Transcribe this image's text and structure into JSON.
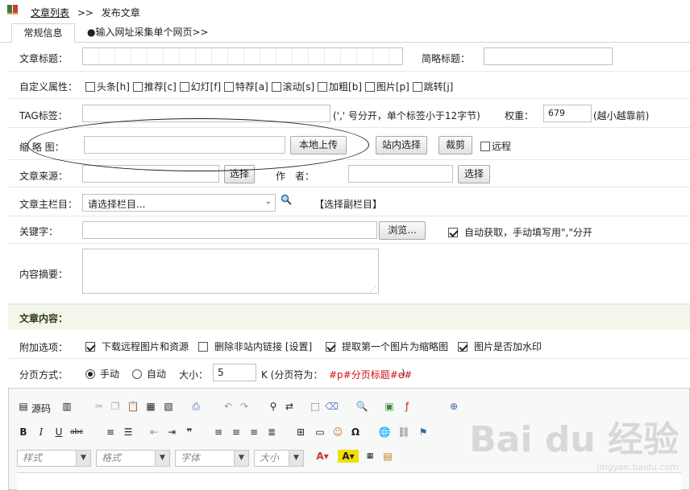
{
  "breadcrumb": {
    "link": "文章列表",
    "separator": ">>",
    "current": "发布文章"
  },
  "tabs": [
    {
      "label": "常规信息"
    },
    {
      "label": "●输入网址采集单个网页>>"
    }
  ],
  "fields": {
    "title_label": "文章标题：",
    "short_title_label": "简略标题：",
    "attr_label": "自定义属性：",
    "attrs": [
      "头条[h]",
      "推荐[c]",
      "幻灯[f]",
      "特荐[a]",
      "滚动[s]",
      "加粗[b]",
      "图片[p]",
      "跳转[j]"
    ],
    "tag_label": "TAG标签：",
    "tag_hint": "(',' 号分开，单个标签小于12字节)",
    "weight_label": "权重：",
    "weight_value": "679",
    "weight_hint": "(越小越靠前)",
    "thumb_label": "缩 略 图：",
    "upload_button": "本地上传",
    "site_select_button": "站内选择",
    "crop_button": "裁剪",
    "remote_label": "远程",
    "source_label": "文章来源：",
    "select_button": "选择",
    "author_label": "作　者：",
    "column_label": "文章主栏目：",
    "column_value": "请选择栏目...",
    "sub_column_link": "【选择副栏目】",
    "keywords_label": "关键字：",
    "browse_button": "浏览...",
    "auto_keywords_label": "自动获取，手动填写用\",\"分开",
    "summary_label": "内容摘要："
  },
  "content_section": {
    "title": "文章内容：",
    "extra_label": "附加选项：",
    "extra_options": [
      {
        "label": "下载远程图片和资源",
        "checked": true
      },
      {
        "label": "删除非站内链接 [设置]",
        "checked": false
      },
      {
        "label": "提取第一个图片为缩略图",
        "checked": true
      },
      {
        "label": "图片是否加水印",
        "checked": true
      }
    ],
    "paging_label": "分页方式：",
    "paging_manual": "手动",
    "paging_auto": "自动",
    "size_label": "大小：",
    "size_value": "5",
    "size_unit": "K (分页符为：",
    "page_marker": "#p#分页标题#e#",
    "close_paren": ")"
  },
  "editor": {
    "source_label": "源码",
    "combos": [
      "样式",
      "格式",
      "字体",
      "大小"
    ]
  },
  "watermark": {
    "main": "Bai du 经验",
    "sub": "jingyan.baidu.com"
  }
}
